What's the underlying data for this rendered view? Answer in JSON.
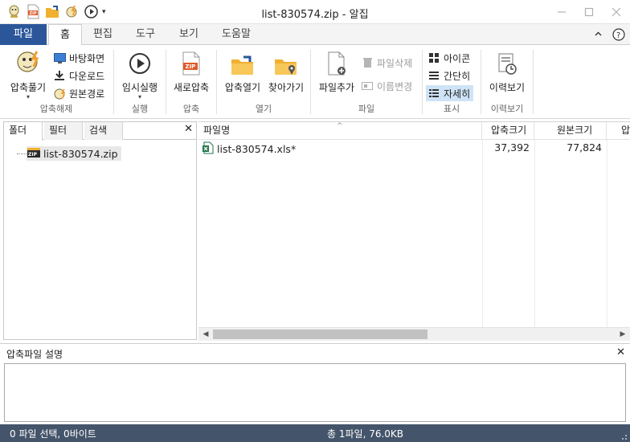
{
  "window": {
    "title": "list-830574.zip - 알집"
  },
  "quick_access": {
    "icons": [
      "app-logo-icon",
      "new-zip-icon",
      "open-folder-icon",
      "extract-icon",
      "play-icon"
    ],
    "dropdown_glyph": "▾"
  },
  "window_controls": {
    "minimize": "—",
    "maximize": "☐",
    "close": "✕"
  },
  "tabs": {
    "file": "파일",
    "home": "홈",
    "edit": "편집",
    "tools": "도구",
    "view": "보기",
    "help": "도움말"
  },
  "ribbon": {
    "extract_group": {
      "label": "압축해제",
      "extract": "압축풀기",
      "desktop": "바탕화면",
      "downloads": "다운로드",
      "original_path": "원본경로"
    },
    "run_group": {
      "label": "실행",
      "temp_run": "임시실행"
    },
    "compress_group": {
      "label": "압축",
      "new_zip": "새로압축"
    },
    "open_group": {
      "label": "열기",
      "open_zip": "압축열기",
      "find": "찾아가기"
    },
    "file_group": {
      "label": "파일",
      "add_file": "파일추가",
      "delete_file": "파일삭제",
      "rename": "이름변경"
    },
    "display_group": {
      "label": "표시",
      "icons": "아이콘",
      "simple": "간단히",
      "details": "자세히"
    },
    "history_group": {
      "label": "이력보기",
      "history": "이력보기"
    }
  },
  "left_panel": {
    "tabs": [
      "폴더",
      "필터",
      "검색"
    ],
    "close": "✕",
    "tree_item": "list-830574.zip"
  },
  "file_list": {
    "columns": {
      "name": "파일명",
      "compressed": "압축크기",
      "original": "원본크기",
      "extra": "압"
    },
    "sort_glyph": "^",
    "rows": [
      {
        "name": "list-830574.xls*",
        "compressed": "37,392",
        "original": "77,824"
      }
    ]
  },
  "description": {
    "title": "압축파일 설명",
    "close": "✕"
  },
  "status": {
    "left": "0 파일 선택,  0바이트",
    "middle": "총 1파일,  76.0KB"
  },
  "colors": {
    "file_tab": "#2b579a",
    "status_bar": "#44546a",
    "selected_view": "#cfe3f7",
    "accent_orange": "#f0a030"
  }
}
